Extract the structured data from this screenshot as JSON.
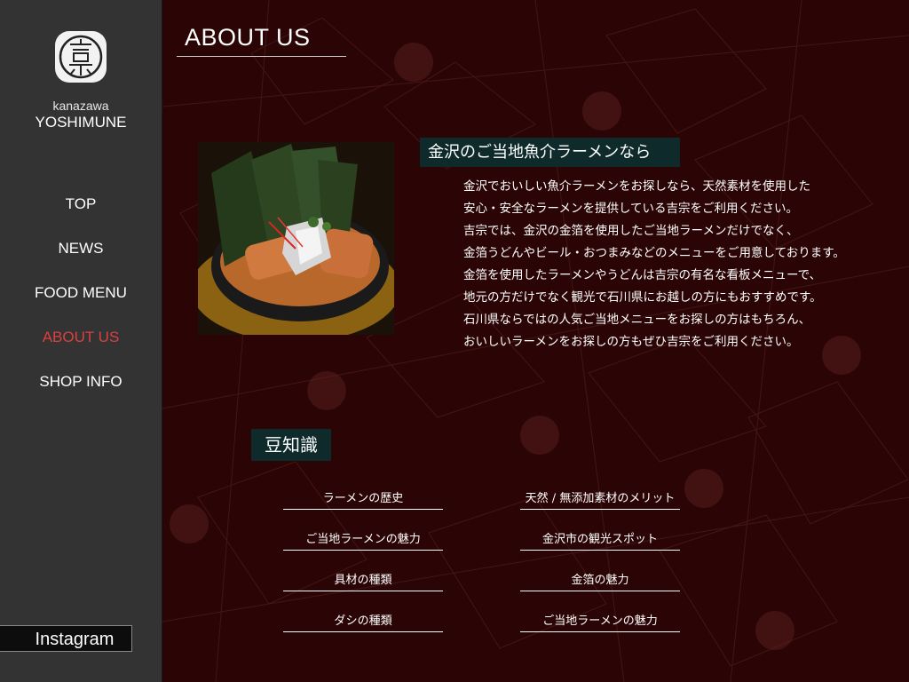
{
  "sidebar": {
    "logo_icon": "yoshimune-kanji-logo-icon",
    "brand_small": "kanazawa",
    "brand_large": "YOSHIMUNE",
    "nav": [
      {
        "label": "TOP",
        "active": false
      },
      {
        "label": "NEWS",
        "active": false
      },
      {
        "label": "FOOD MENU",
        "active": false
      },
      {
        "label": "ABOUT US",
        "active": true
      },
      {
        "label": "SHOP INFO",
        "active": false
      }
    ],
    "instagram_label": "Instagram",
    "active_color": "#d94040"
  },
  "main": {
    "title": "ABOUT US",
    "photo": "ramen-bowl-with-gold-leaf-photo",
    "section1": {
      "heading": "金沢のご当地魚介ラーメンなら",
      "lines": [
        "金沢でおいしい魚介ラーメンをお探しなら、天然素材を使用した",
        "安心・安全なラーメンを提供している吉宗をご利用ください。",
        "吉宗では、金沢の金箔を使用したご当地ラーメンだけでなく、",
        "金箔うどんやビール・おつまみなどのメニューをご用意しております。",
        "金箔を使用したラーメンやうどんは吉宗の有名な看板メニューで、",
        "地元の方だけでなく観光で石川県にお越しの方にもおすすめです。",
        "石川県ならではの人気ご当地メニューをお探しの方はもちろん、",
        "おいしいラーメンをお探しの方もぜひ吉宗をご利用ください。"
      ]
    },
    "section2": {
      "heading": "豆知識",
      "links": [
        "ラーメンの歴史",
        "天然 / 無添加素材のメリット",
        "ご当地ラーメンの魅力",
        "金沢市の観光スポット",
        "具材の種類",
        "金箔の魅力",
        "ダシの種類",
        "ご当地ラーメンの魅力"
      ]
    }
  },
  "colors": {
    "background": "#2b0505",
    "sidebar": "#333333",
    "heading_box": "#0f2a2a"
  }
}
